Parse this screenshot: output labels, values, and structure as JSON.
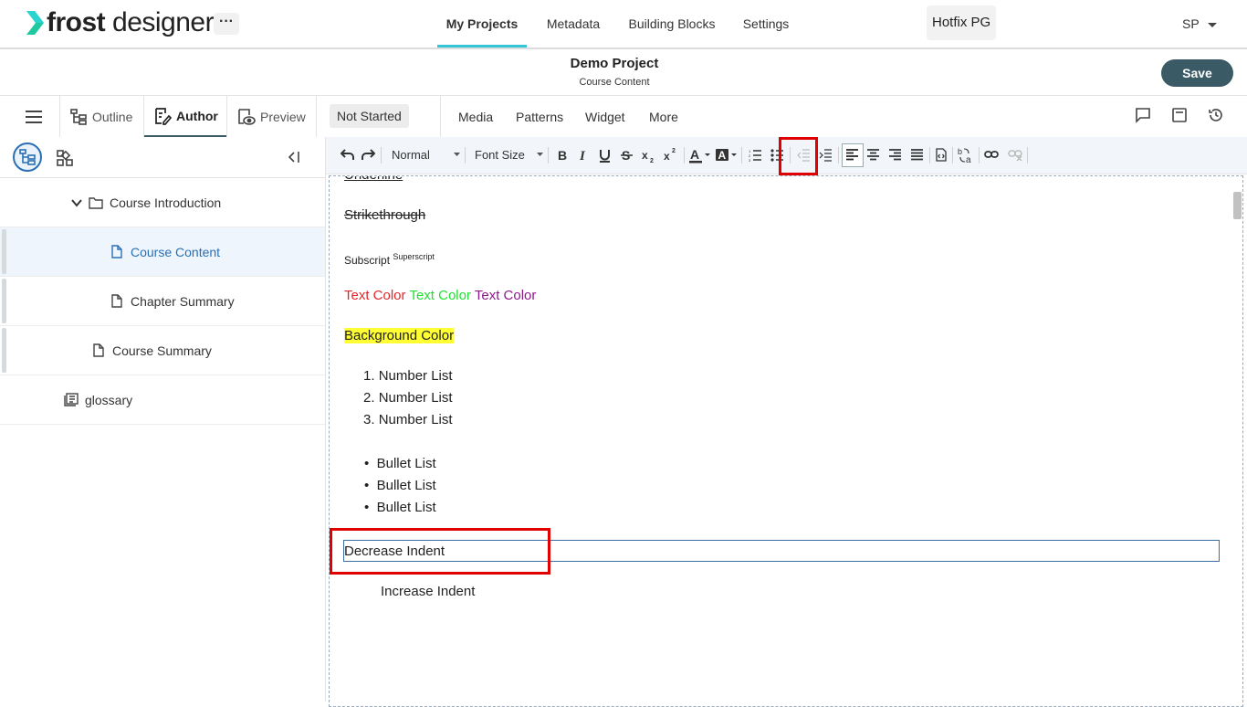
{
  "app": {
    "logo_bold": "frost",
    "logo_light": " designer",
    "more_label": "···"
  },
  "nav": {
    "tabs": [
      "My Projects",
      "Metadata",
      "Building Blocks",
      "Settings"
    ],
    "active_tab": "My Projects",
    "workspace": "Hotfix PG",
    "user_initials": "SP"
  },
  "project": {
    "title": "Demo Project",
    "subtitle": "Course Content",
    "save_label": "Save"
  },
  "modes": {
    "outline": "Outline",
    "author": "Author",
    "preview": "Preview",
    "status": "Not Started",
    "menu": [
      "Media",
      "Patterns",
      "Widget",
      "More"
    ]
  },
  "sidebar": {
    "items": [
      {
        "label": "Course Introduction",
        "type": "folder"
      },
      {
        "label": "Course Content",
        "type": "page",
        "active": true
      },
      {
        "label": "Chapter Summary",
        "type": "page"
      },
      {
        "label": "Course Summary",
        "type": "page"
      },
      {
        "label": "glossary",
        "type": "glossary"
      }
    ]
  },
  "toolbar": {
    "style_select": "Normal",
    "font_size_select": "Font Size"
  },
  "editor": {
    "underline": "Underline",
    "strikethrough": "Strikethrough",
    "subscript": "Subscript",
    "superscript": "Superscript",
    "text_color_1": "Text Color",
    "text_color_2": "Text Color",
    "text_color_3": "Text Color",
    "background_color": "Background Color",
    "number_list": [
      "Number List",
      "Number List",
      "Number List"
    ],
    "bullet_list": [
      "Bullet List",
      "Bullet List",
      "Bullet List"
    ],
    "decrease_indent": "Decrease Indent",
    "increase_indent": "Increase Indent"
  },
  "colors": {
    "accent": "#36c5d4",
    "save_button": "#3a5a66",
    "text_red": "#e4262b",
    "text_green": "#22e033",
    "text_purple": "#8b1a8b",
    "highlight": "#ffff33",
    "annotation": "#e10000"
  }
}
